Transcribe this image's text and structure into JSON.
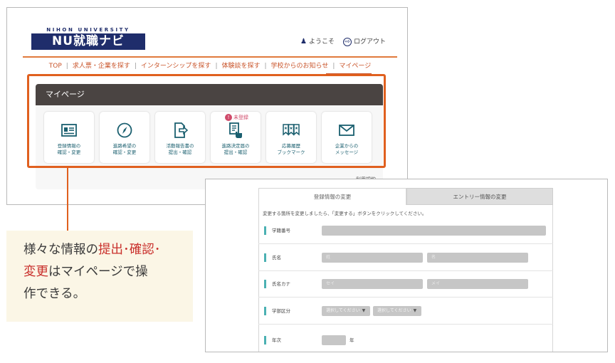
{
  "site": {
    "logo_top": "NIHON UNIVERSITY",
    "logo_main": "NU就職ナビ",
    "welcome": "ようこそ",
    "logout": "ログアウト"
  },
  "nav": {
    "items": [
      "TOP",
      "求人票・企業を探す",
      "インターンシップを探す",
      "体験談を探す",
      "学校からのお知らせ",
      "マイページ"
    ],
    "active": "マイページ"
  },
  "mypage": {
    "title": "マイページ",
    "badge": "未登録",
    "cards": [
      {
        "label": "登録情報の\n確認・変更",
        "icon": "id-card-icon"
      },
      {
        "label": "進路希望の\n確認・変更",
        "icon": "compass-icon"
      },
      {
        "label": "活動報告書の\n提出・確認",
        "icon": "document-arrow-icon"
      },
      {
        "label": "進路決定届の\n提出・確認",
        "icon": "document-hand-icon"
      },
      {
        "label": "応募履歴\nブックマーク",
        "icon": "bookmark-stars-icon"
      },
      {
        "label": "企業からの\nメッセージ",
        "icon": "envelope-icon"
      }
    ],
    "terms": "利用規約"
  },
  "callout": {
    "line1_plain": "様々な情報の",
    "line1_hl": "提出･確認･",
    "line2_hl": "変更",
    "line2_plain": "はマイページで操",
    "line3_plain": "作できる。"
  },
  "form": {
    "tab_active": "登録情報の変更",
    "tab_inactive": "エントリー情報の変更",
    "instruction": "変更する箇所を変更しましたら、「変更する」ボタンをクリックしてください。",
    "rows": {
      "student_no": "学籍番号",
      "name": "氏名",
      "name_kana": "氏名カナ",
      "department": "学部区分",
      "year": "年次"
    },
    "placeholders": {
      "sei": "姓",
      "mei": "名",
      "sei_kana": "セイ",
      "mei_kana": "メイ",
      "select1": "選択してください",
      "select2": "選択してください"
    },
    "year_unit": "年"
  },
  "colors": {
    "brand_navy": "#1f2d6b",
    "highlight_orange": "#e0601f",
    "accent_red": "#c9302c",
    "teal": "#4bb1b3"
  }
}
